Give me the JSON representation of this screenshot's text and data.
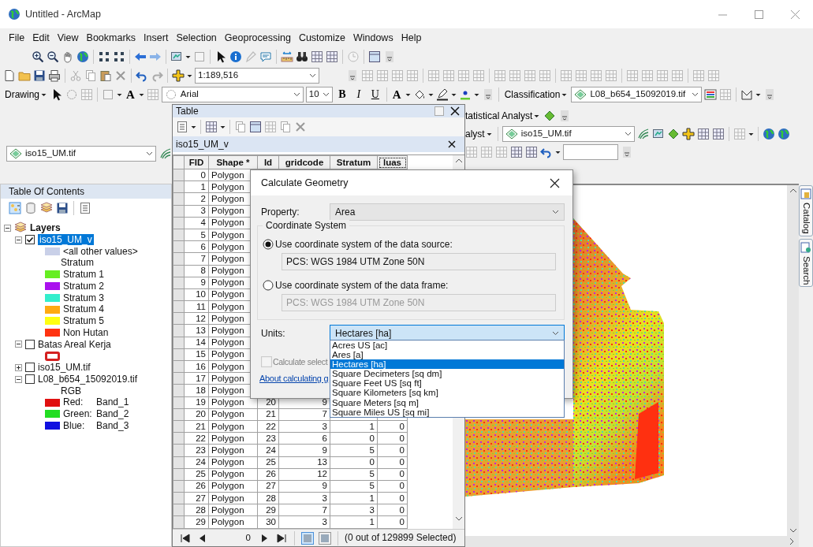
{
  "window": {
    "title": "Untitled - ArcMap"
  },
  "menu": [
    "File",
    "Edit",
    "View",
    "Bookmarks",
    "Insert",
    "Selection",
    "Geoprocessing",
    "Customize",
    "Windows",
    "Help"
  ],
  "toolbars": {
    "scale": "1:189,516",
    "drawing_label": "Drawing",
    "text_tool": "A",
    "font": "Arial",
    "font_size": "10",
    "format_buttons": [
      "B",
      "I",
      "U"
    ],
    "font_color": "A",
    "classification_label": "Classification",
    "classification_layer": "L08_b654_15092019.tif",
    "statistical_analyst": "tatistical Analyst",
    "analyst": "alyst",
    "analyst_layer": "iso15_UM.tif",
    "left_layer": "iso15_UM.tif"
  },
  "toc": {
    "title": "Table Of Contents",
    "tree": [
      {
        "label": "Layers",
        "kind": "group",
        "expanded": true,
        "children": [
          {
            "label": "iso15_UM_v",
            "kind": "layer",
            "checked": true,
            "expanded": true,
            "selected": true,
            "children": [
              {
                "kind": "swatch",
                "label": "<all other values>",
                "color": "#c9d0e8"
              },
              {
                "kind": "heading",
                "label": "Stratum"
              },
              {
                "kind": "swatch",
                "label": "Stratum 1",
                "color": "#66ee22"
              },
              {
                "kind": "swatch",
                "label": "Stratum 2",
                "color": "#aa11ee"
              },
              {
                "kind": "swatch",
                "label": "Stratum 3",
                "color": "#33eecc"
              },
              {
                "kind": "swatch",
                "label": "Stratum 4",
                "color": "#ffaa11"
              },
              {
                "kind": "swatch",
                "label": "Stratum 5",
                "color": "#ffff11"
              },
              {
                "kind": "swatch",
                "label": "Non Hutan",
                "color": "#ff3311"
              }
            ]
          },
          {
            "label": "Batas Areal Kerja",
            "kind": "layer",
            "checked": false,
            "expanded": true,
            "selected": false,
            "children": [
              {
                "kind": "outline",
                "color": "#d42020"
              }
            ]
          },
          {
            "label": "iso15_UM.tif",
            "kind": "layer",
            "checked": false,
            "expanded": false,
            "selected": false
          },
          {
            "label": "L08_b654_15092019.tif",
            "kind": "layer",
            "checked": false,
            "expanded": true,
            "selected": false,
            "children": [
              {
                "kind": "heading",
                "label": "RGB"
              },
              {
                "kind": "band",
                "label": "Red:",
                "band": "Band_1",
                "color": "#e01010"
              },
              {
                "kind": "band",
                "label": "Green:",
                "band": "Band_2",
                "color": "#22dd22"
              },
              {
                "kind": "band",
                "label": "Blue:",
                "band": "Band_3",
                "color": "#1010e0"
              }
            ]
          }
        ]
      }
    ]
  },
  "table_window": {
    "title": "Table",
    "layer_tab": "iso15_UM_v",
    "columns": [
      {
        "label": "FID",
        "focused": false
      },
      {
        "label": "Shape *",
        "focused": false
      },
      {
        "label": "Id",
        "focused": false
      },
      {
        "label": "gridcode",
        "focused": false
      },
      {
        "label": "Stratum",
        "focused": false
      },
      {
        "label": "luas",
        "focused": true
      }
    ],
    "rows": [
      [
        "0",
        "Polygon"
      ],
      [
        "1",
        "Polygon"
      ],
      [
        "2",
        "Polygon"
      ],
      [
        "3",
        "Polygon"
      ],
      [
        "4",
        "Polygon"
      ],
      [
        "5",
        "Polygon"
      ],
      [
        "6",
        "Polygon"
      ],
      [
        "7",
        "Polygon"
      ],
      [
        "8",
        "Polygon"
      ],
      [
        "9",
        "Polygon"
      ],
      [
        "10",
        "Polygon"
      ],
      [
        "11",
        "Polygon"
      ],
      [
        "12",
        "Polygon"
      ],
      [
        "13",
        "Polygon"
      ],
      [
        "14",
        "Polygon"
      ],
      [
        "15",
        "Polygon"
      ],
      [
        "16",
        "Polygon"
      ],
      [
        "17",
        "Polygon"
      ],
      [
        "18",
        "Polygon"
      ],
      [
        "19",
        "Polygon",
        "20",
        "9"
      ],
      [
        "20",
        "Polygon",
        "21",
        "7"
      ],
      [
        "21",
        "Polygon",
        "22",
        "3",
        "1",
        "0"
      ],
      [
        "22",
        "Polygon",
        "23",
        "6",
        "0",
        "0"
      ],
      [
        "23",
        "Polygon",
        "24",
        "9",
        "5",
        "0"
      ],
      [
        "24",
        "Polygon",
        "25",
        "13",
        "0",
        "0"
      ],
      [
        "25",
        "Polygon",
        "26",
        "12",
        "5",
        "0"
      ],
      [
        "26",
        "Polygon",
        "27",
        "9",
        "5",
        "0"
      ],
      [
        "27",
        "Polygon",
        "28",
        "3",
        "1",
        "0"
      ],
      [
        "28",
        "Polygon",
        "29",
        "7",
        "3",
        "0"
      ],
      [
        "29",
        "Polygon",
        "30",
        "3",
        "1",
        "0"
      ]
    ],
    "record": "0",
    "views": [
      {
        "selected": true
      },
      {
        "selected": false
      }
    ],
    "status": "(0 out of 129899 Selected)"
  },
  "dialog": {
    "title": "Calculate Geometry",
    "property_label": "Property:",
    "property_value": "Area",
    "group_title": "Coordinate System",
    "options": [
      {
        "label": "Use coordinate system of the data source:",
        "value": "PCS: WGS 1984 UTM Zone 50N",
        "selected": true
      },
      {
        "label": "Use coordinate system of the data frame:",
        "value": "PCS: WGS 1984 UTM Zone 50N",
        "selected": false
      }
    ],
    "units_label": "Units:",
    "units_value": "Hectares [ha]",
    "units_options": [
      {
        "label": "Acres US [ac]",
        "selected": false
      },
      {
        "label": "Ares [a]",
        "selected": false
      },
      {
        "label": "Hectares [ha]",
        "selected": true
      },
      {
        "label": "Square Decimeters [sq dm]",
        "selected": false
      },
      {
        "label": "Square Feet US [sq ft]",
        "selected": false
      },
      {
        "label": "Square Kilometers [sq km]",
        "selected": false
      },
      {
        "label": "Square Meters [sq m]",
        "selected": false
      },
      {
        "label": "Square Miles US [sq mi]",
        "selected": false
      }
    ],
    "checkbox": {
      "label": "Calculate select",
      "checked": false,
      "disabled": true
    },
    "link": "About calculating g"
  },
  "side_tabs": [
    "Catalog",
    "Search"
  ]
}
